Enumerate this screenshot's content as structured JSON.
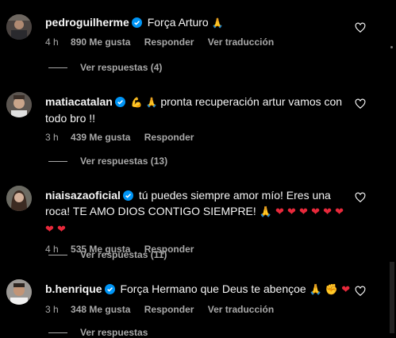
{
  "comments": [
    {
      "username": "pedroguilherme",
      "text": "Força Arturo",
      "emoji": "🙏",
      "time": "4 h",
      "likes": "890 Me gusta",
      "reply": "Responder",
      "translate": "Ver traducción",
      "replies": "Ver respuestas (4)"
    },
    {
      "username": "matiacatalan",
      "emoji_pre": "💪 🙏",
      "text": "pronta recuperación artur vamos con todo bro !!",
      "time": "3 h",
      "likes": "439 Me gusta",
      "reply": "Responder",
      "replies": "Ver respuestas (13)"
    },
    {
      "username": "niaisazaoficial",
      "text": "tú puedes siempre amor mío! Eres una roca! TE AMO DIOS CONTIGO SIEMPRE!",
      "emoji": "🙏 ❤ ❤ ❤ ❤ ❤ ❤ ❤ ❤",
      "time": "4 h",
      "likes": "535 Me gusta",
      "reply": "Responder",
      "replies": "Ver respuestas (11)"
    },
    {
      "username": "b.henrique",
      "text": "Força Hermano que Deus te abençoe",
      "emoji": "🙏 ✊ ❤",
      "time": "3 h",
      "likes": "348 Me gusta",
      "reply": "Responder",
      "translate": "Ver traducción",
      "replies": "Ver respuestas"
    }
  ],
  "icons": {
    "verified": "verified-badge-icon",
    "like": "heart-outline-icon"
  },
  "colors": {
    "background": "#000000",
    "text": "#f5f5f5",
    "muted": "#a8a8a8",
    "verified": "#0095f6"
  }
}
